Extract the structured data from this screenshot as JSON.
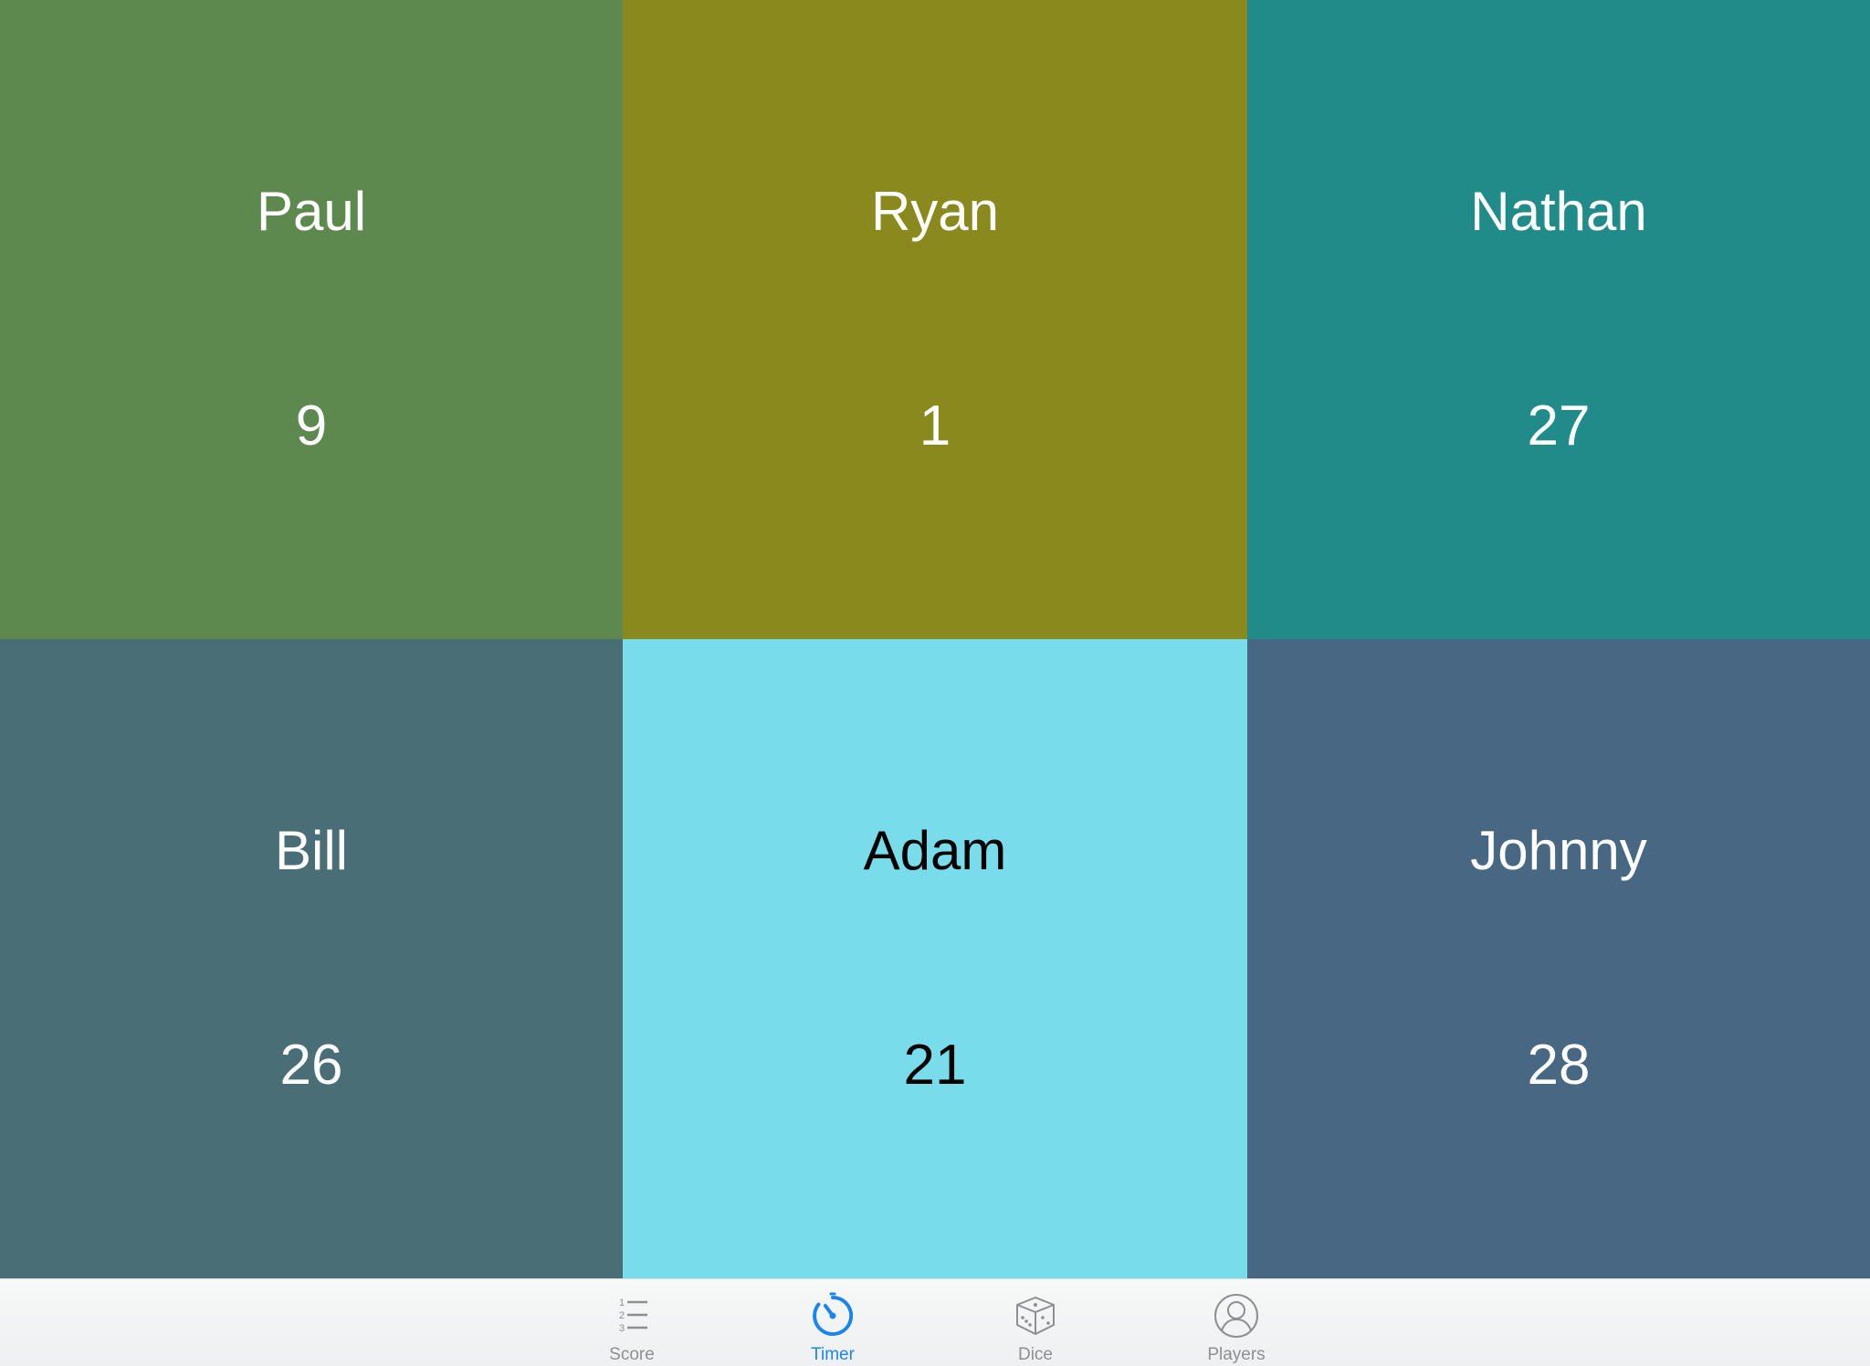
{
  "players": [
    {
      "name": "Paul",
      "score": "9",
      "bg": "#5d894e",
      "fg": "#ffffff"
    },
    {
      "name": "Ryan",
      "score": "1",
      "bg": "#8a891e",
      "fg": "#ffffff"
    },
    {
      "name": "Nathan",
      "score": "27",
      "bg": "#218b89",
      "fg": "#ffffff"
    },
    {
      "name": "Bill",
      "score": "26",
      "bg": "#4a6e76",
      "fg": "#ffffff"
    },
    {
      "name": "Adam",
      "score": "21",
      "bg": "#79dcea",
      "fg": "#000000"
    },
    {
      "name": "Johnny",
      "score": "28",
      "bg": "#486782",
      "fg": "#ffffff"
    }
  ],
  "tabbar": {
    "tabs": [
      {
        "label": "Score",
        "icon": "score-list-icon",
        "active": false
      },
      {
        "label": "Timer",
        "icon": "timer-icon",
        "active": true
      },
      {
        "label": "Dice",
        "icon": "dice-icon",
        "active": false
      },
      {
        "label": "Players",
        "icon": "players-icon",
        "active": false
      }
    ]
  },
  "colors": {
    "active_tab": "#1a84f2",
    "inactive_tab": "#8e8e93"
  }
}
